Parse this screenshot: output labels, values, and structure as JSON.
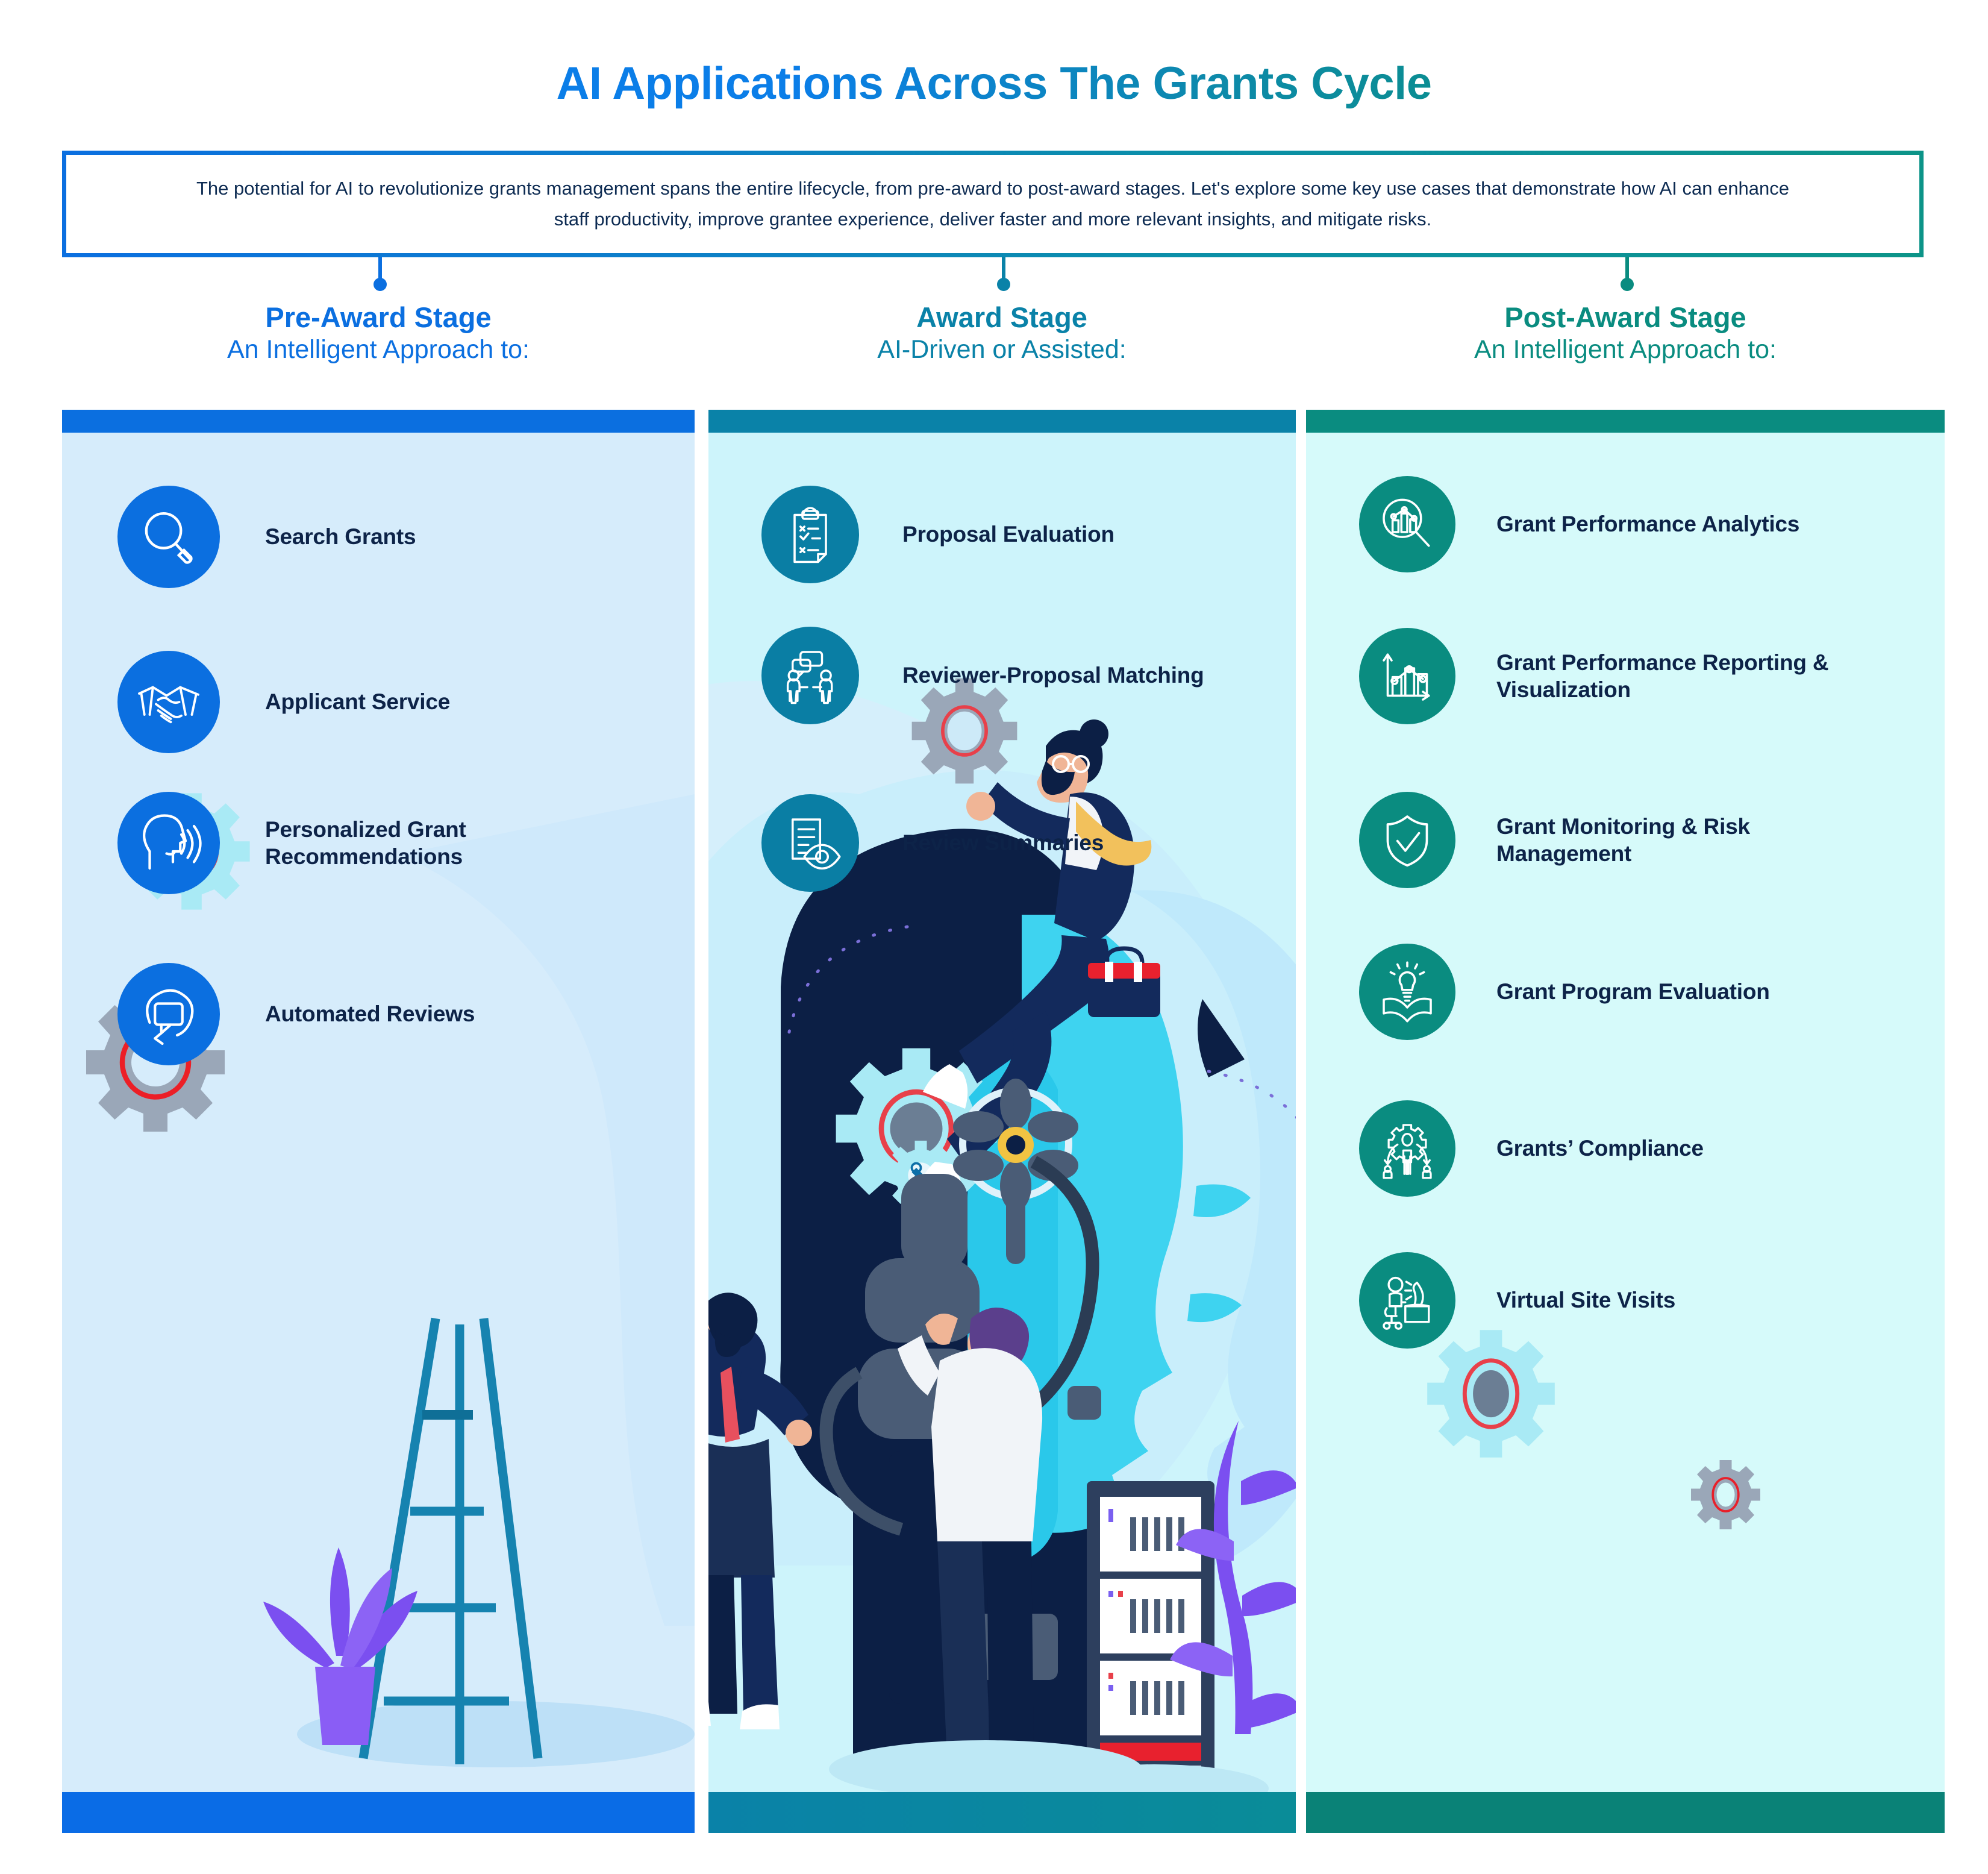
{
  "title": "AI Applications Across The Grants Cycle",
  "intro": "The potential for AI to revolutionize grants management spans the entire lifecycle, from pre-award to post-award stages. Let's explore some key use cases that demonstrate how AI can enhance staff productivity, improve grantee experience, deliver faster and more relevant insights, and mitigate risks.",
  "colors": {
    "pre_award_accent": "#0b6fe0",
    "award_accent": "#0a82a8",
    "post_award_accent": "#0a8c80",
    "pre_award_panel": "#d6ecfb",
    "award_panel": "#cdf4fb",
    "post_award_panel": "#d6fafa",
    "label_text": "#0d2348",
    "gear_grey": "#9aa7b8",
    "gear_light": "#a9eaf5",
    "gear_ring_red": "#e8202a"
  },
  "columns": [
    {
      "id": "pre-award",
      "heading": "Pre-Award Stage",
      "subheading": "An Intelligent Approach to:",
      "items": [
        {
          "label": "Search Grants",
          "icon": "magnifier-icon"
        },
        {
          "label": "Applicant Service",
          "icon": "handshake-icon"
        },
        {
          "label": "Personalized Grant Recommendations",
          "icon": "speaking-head-icon"
        },
        {
          "label": "Automated Reviews",
          "icon": "chat-refresh-icon"
        }
      ]
    },
    {
      "id": "award",
      "heading": "Award Stage",
      "subheading": "AI-Driven or Assisted:",
      "items": [
        {
          "label": "Proposal Evaluation",
          "icon": "clipboard-checklist-icon"
        },
        {
          "label": "Reviewer-Proposal Matching",
          "icon": "two-people-chat-icon"
        },
        {
          "label": "Review Summaries",
          "icon": "document-eye-icon"
        }
      ]
    },
    {
      "id": "post-award",
      "heading": "Post-Award Stage",
      "subheading": "An Intelligent Approach to:",
      "items": [
        {
          "label": "Grant Performance Analytics",
          "icon": "chart-magnifier-icon"
        },
        {
          "label": "Grant Performance Reporting & Visualization",
          "icon": "bar-line-chart-icon"
        },
        {
          "label": "Grant Monitoring & Risk Management",
          "icon": "shield-check-icon"
        },
        {
          "label": "Grant Program Evaluation",
          "icon": "book-lightbulb-icon"
        },
        {
          "label": "Grants’ Compliance",
          "icon": "gear-people-icon"
        },
        {
          "label": "Virtual Site Visits",
          "icon": "desk-screen-icon"
        }
      ]
    }
  ]
}
